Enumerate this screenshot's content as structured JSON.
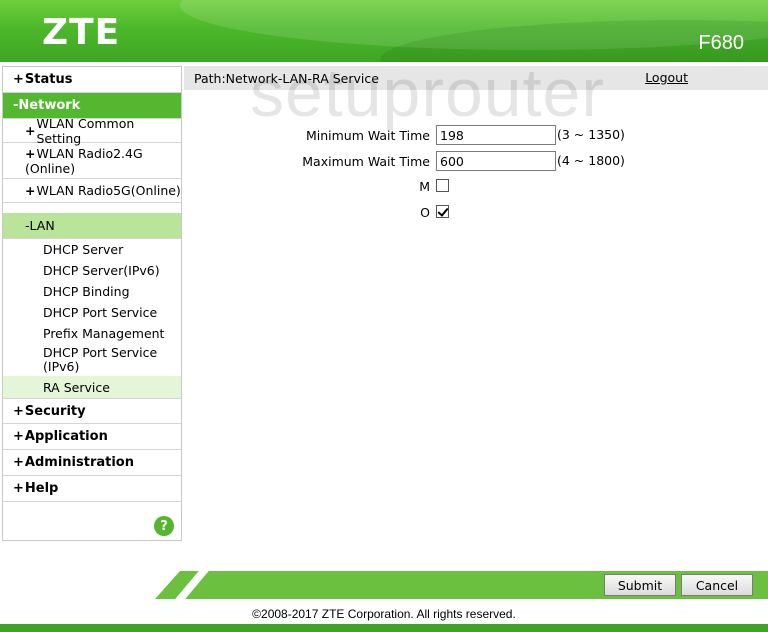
{
  "header": {
    "logo": "ZTE",
    "model": "F680"
  },
  "sidebar": {
    "status": "Status",
    "network": "Network",
    "wlan_common": "WLAN Common Setting",
    "wlan_24_line1": "WLAN Radio2.4G",
    "wlan_24_line2": "(Online)",
    "wlan_5g": "WLAN Radio5G(Online)",
    "lan": "LAN",
    "lan_items": {
      "dhcp_server": "DHCP Server",
      "dhcp_server_ipv6": "DHCP Server(IPv6)",
      "dhcp_binding": "DHCP Binding",
      "dhcp_port_service": "DHCP Port Service",
      "prefix_management": "Prefix Management",
      "dhcp_port_service_ipv6_line1": "DHCP Port Service",
      "dhcp_port_service_ipv6_line2": "(IPv6)",
      "ra_service": "RA Service"
    },
    "security": "Security",
    "application": "Application",
    "administration": "Administration",
    "help": "Help",
    "help_icon": "?"
  },
  "main": {
    "path": "Path:Network-LAN-RA Service",
    "logout": "Logout",
    "watermark": "setuprouter",
    "min_wait_label": "Minimum Wait Time",
    "min_wait_value": "198",
    "min_wait_range": "(3 ~ 1350)",
    "max_wait_label": "Maximum Wait Time",
    "max_wait_value": "600",
    "max_wait_range": "(4 ~ 1800)",
    "m_label": "M",
    "m_checked": false,
    "o_label": "O",
    "o_checked": true
  },
  "buttons": {
    "submit": "Submit",
    "cancel": "Cancel"
  },
  "footer": {
    "copyright": "©2008-2017 ZTE Corporation. All rights reserved."
  },
  "colors": {
    "brand_green": "#53b830",
    "active_sub": "#b8e59a",
    "active_leaf": "#e4f5d8"
  }
}
